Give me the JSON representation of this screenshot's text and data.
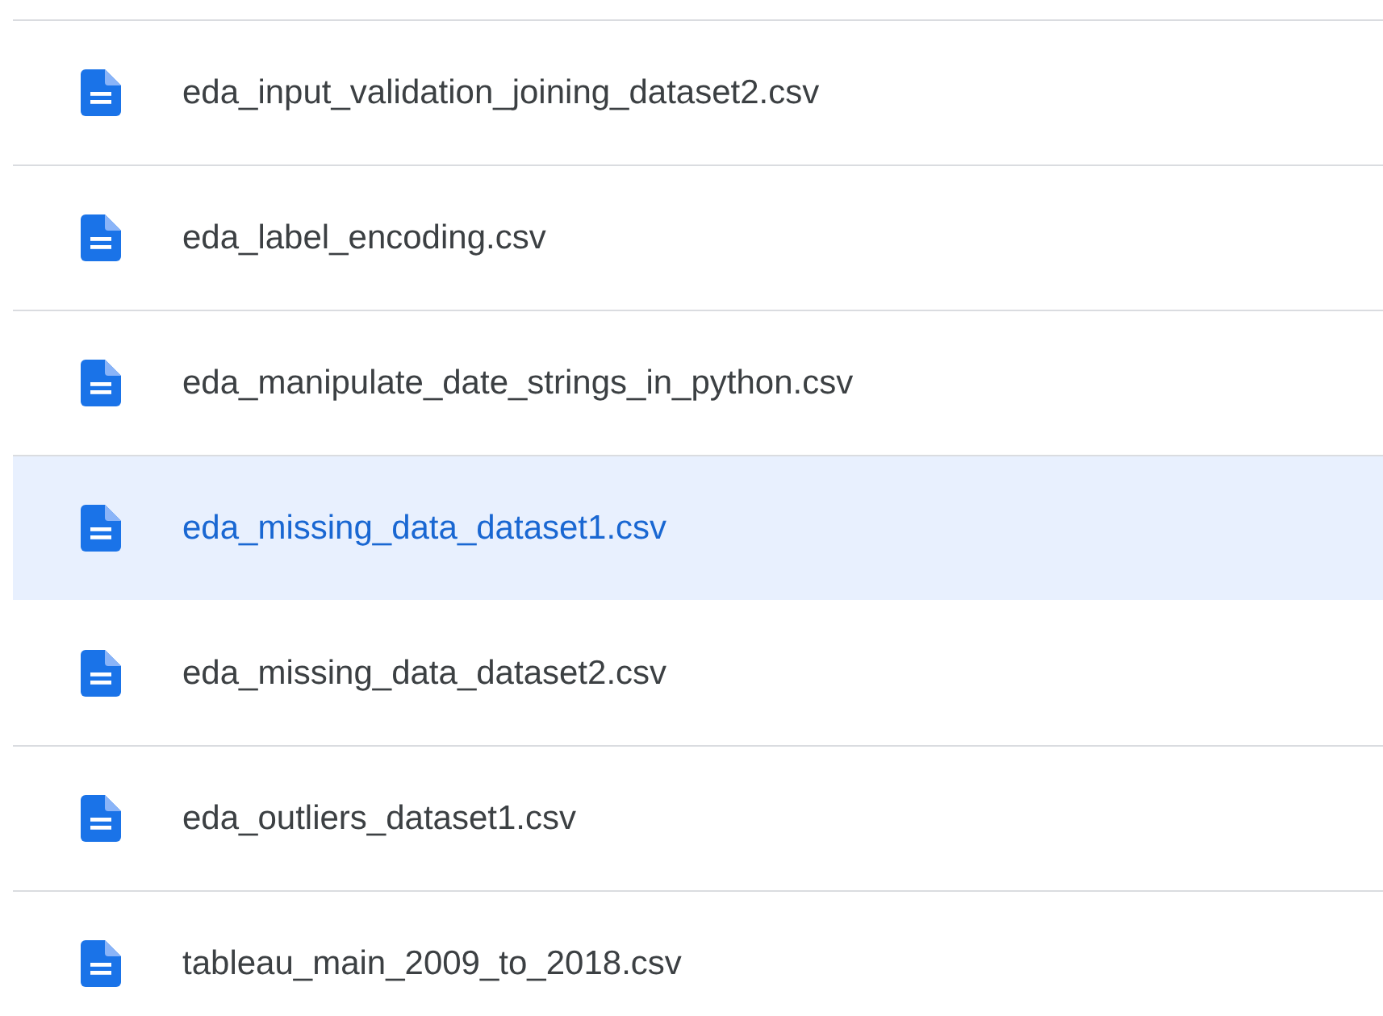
{
  "files": [
    {
      "name": "eda_input_validation_joining_dataset2.csv",
      "selected": false
    },
    {
      "name": "eda_label_encoding.csv",
      "selected": false
    },
    {
      "name": "eda_manipulate_date_strings_in_python.csv",
      "selected": false
    },
    {
      "name": "eda_missing_data_dataset1.csv",
      "selected": true
    },
    {
      "name": "eda_missing_data_dataset2.csv",
      "selected": false
    },
    {
      "name": "eda_outliers_dataset1.csv",
      "selected": false
    },
    {
      "name": "tableau_main_2009_to_2018.csv",
      "selected": false
    }
  ]
}
